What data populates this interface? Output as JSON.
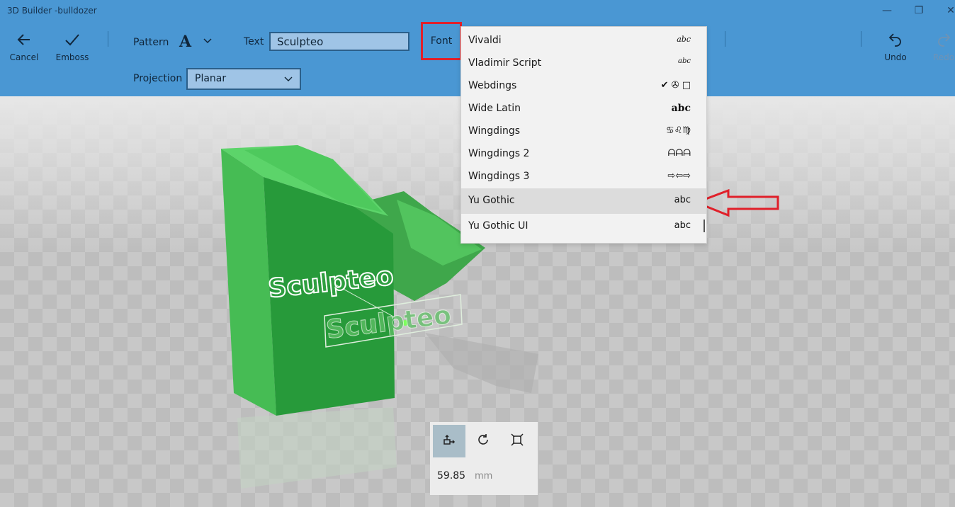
{
  "window": {
    "title": "3D Builder -bulldozer",
    "controls": {
      "minimize": "—",
      "restore": "❐",
      "close": "✕"
    }
  },
  "toolbar": {
    "cancel_label": "Cancel",
    "emboss_label": "Emboss",
    "pattern_label": "Pattern",
    "pattern_glyph": "A",
    "text_label": "Text",
    "text_value": "Sculpteo",
    "font_label": "Font",
    "projection_label": "Projection",
    "projection_value": "Planar",
    "undo_label": "Undo",
    "redo_label": "Redo"
  },
  "font_list": {
    "items": [
      {
        "name": "Vivaldi",
        "preview": "abc"
      },
      {
        "name": "Vladimir Script",
        "preview": "abc"
      },
      {
        "name": "Webdings",
        "preview": "✔ ✇ □"
      },
      {
        "name": "Wide Latin",
        "preview": "abc"
      },
      {
        "name": "Wingdings",
        "preview": "♋♌♍"
      },
      {
        "name": "Wingdings 2",
        "preview": "ᗩᗩᗩ"
      },
      {
        "name": "Wingdings 3",
        "preview": "⇨⇦⇨"
      },
      {
        "name": "Yu Gothic",
        "preview": "abc"
      },
      {
        "name": "Yu Gothic UI",
        "preview": "abc"
      }
    ],
    "selected": "Yu Gothic"
  },
  "viewport": {
    "embossed_text": "Sculpteo",
    "embossed_text_preview": "Sculpteo"
  },
  "tool_panel": {
    "size_value": "59.85",
    "size_unit": "mm"
  },
  "colors": {
    "toolbar_bg": "#4a97d3",
    "highlight_red": "#e0202a",
    "model_green": "#3fb74f"
  }
}
